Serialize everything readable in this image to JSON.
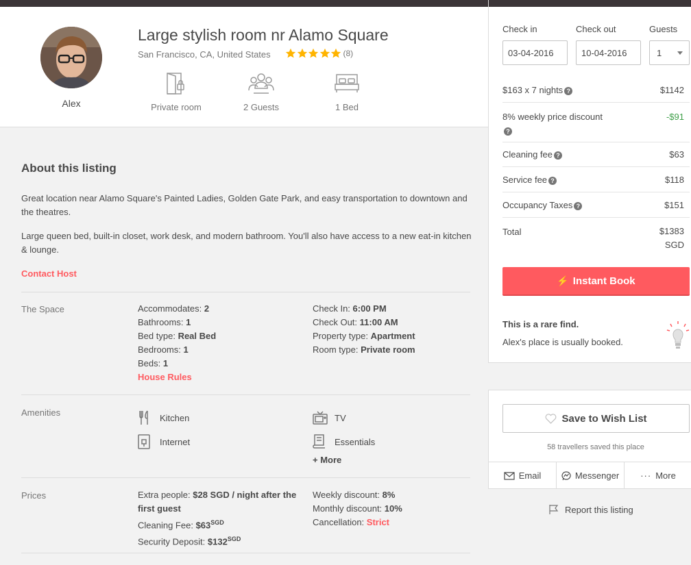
{
  "header": {
    "title": "Large stylish room nr Alamo Square",
    "location": "San Francisco, CA, United States",
    "review_count": "(8)",
    "rating": 5,
    "host_name": "Alex",
    "features": [
      {
        "label": "Private room",
        "icon": "door-icon"
      },
      {
        "label": "2 Guests",
        "icon": "guests-icon"
      },
      {
        "label": "1 Bed",
        "icon": "bed-icon"
      }
    ]
  },
  "about": {
    "heading": "About this listing",
    "para1": "Great location near Alamo Square's Painted Ladies, Golden Gate Park, and easy transportation to downtown and the theatres.",
    "para2": "Large queen bed, built-in closet, work desk, and modern bathroom. You'll also have access to a new eat-in kitchen & lounge.",
    "contact": "Contact Host"
  },
  "space": {
    "label": "The Space",
    "left": [
      {
        "k": "Accommodates:",
        "v": "2"
      },
      {
        "k": "Bathrooms:",
        "v": "1"
      },
      {
        "k": "Bed type:",
        "v": "Real Bed"
      },
      {
        "k": "Bedrooms:",
        "v": "1"
      },
      {
        "k": "Beds:",
        "v": "1"
      }
    ],
    "house_rules": "House Rules",
    "right": [
      {
        "k": "Check In:",
        "v": "6:00 PM"
      },
      {
        "k": "Check Out:",
        "v": "11:00 AM"
      },
      {
        "k": "Property type:",
        "v": "Apartment"
      },
      {
        "k": "Room type:",
        "v": "Private room"
      }
    ]
  },
  "amenities": {
    "label": "Amenities",
    "items": [
      "Kitchen",
      "TV",
      "Internet",
      "Essentials"
    ],
    "more": "+ More"
  },
  "prices": {
    "label": "Prices",
    "extra_k": "Extra people:",
    "extra_v": "$28 SGD / night after the first guest",
    "cleaning_k": "Cleaning Fee:",
    "cleaning_v": "$63",
    "cleaning_sup": "SGD",
    "deposit_k": "Security Deposit:",
    "deposit_v": "$132",
    "deposit_sup": "SGD",
    "weekly_k": "Weekly discount:",
    "weekly_v": "8%",
    "monthly_k": "Monthly discount:",
    "monthly_v": "10%",
    "cancel_k": "Cancellation:",
    "cancel_v": "Strict"
  },
  "booking": {
    "checkin_label": "Check in",
    "checkout_label": "Check out",
    "guests_label": "Guests",
    "checkin": "03-04-2016",
    "checkout": "10-04-2016",
    "guests": "1",
    "rows": [
      {
        "label": "$163 x 7 nights",
        "value": "$1142"
      },
      {
        "label": "8% weekly price discount",
        "value": "-$91"
      },
      {
        "label": "Cleaning fee",
        "value": "$63"
      },
      {
        "label": "Service fee",
        "value": "$118"
      },
      {
        "label": "Occupancy Taxes",
        "value": "$151"
      },
      {
        "label": "Total",
        "value": "$1383 SGD"
      }
    ],
    "instant_book": "Instant Book",
    "rare_title": "This is a rare find.",
    "rare_sub": "Alex's place is usually booked.",
    "brand_color": "#ff5a5f",
    "discount_color": "#3d9e47"
  },
  "wishlist": {
    "button": "Save to Wish List",
    "saved": "58 travellers saved this place",
    "share": [
      "Email",
      "Messenger",
      "More"
    ],
    "report": "Report this listing"
  }
}
